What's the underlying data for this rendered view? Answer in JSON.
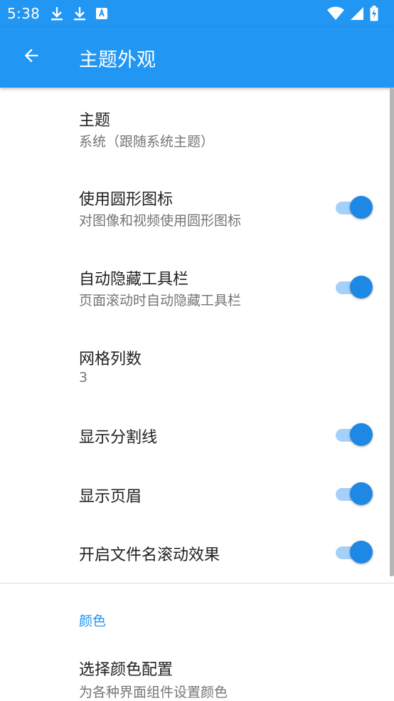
{
  "status_bar": {
    "time": "5:38",
    "left_icons": [
      "download-icon",
      "download-icon",
      "translate-icon"
    ],
    "right_icons": [
      "wifi-icon",
      "signal-icon",
      "battery-charging-icon"
    ]
  },
  "app_bar": {
    "back_icon": "arrow-left-icon",
    "title": "主题外观"
  },
  "preferences": [
    {
      "title": "主题",
      "summary": "系统（跟随系统主题）"
    },
    {
      "title": "使用圆形图标",
      "summary": "对图像和视频使用圆形图标",
      "switch_on": true
    },
    {
      "title": "自动隐藏工具栏",
      "summary": "页面滚动时自动隐藏工具栏",
      "switch_on": true
    },
    {
      "title": "网格列数",
      "summary": "3"
    },
    {
      "title": "显示分割线",
      "switch_on": true
    },
    {
      "title": "显示页眉",
      "switch_on": true
    },
    {
      "title": "开启文件名滚动效果",
      "switch_on": true
    }
  ],
  "color_section": {
    "header": "颜色",
    "items": [
      {
        "title": "选择颜色配置",
        "summary": "为各种界面组件设置颜色"
      }
    ]
  },
  "colors": {
    "primary": "#2196F3",
    "switch_thumb": "#1E88E5",
    "switch_track": "#A5D1F8",
    "title_text": "#212121",
    "summary_text": "#757575"
  }
}
